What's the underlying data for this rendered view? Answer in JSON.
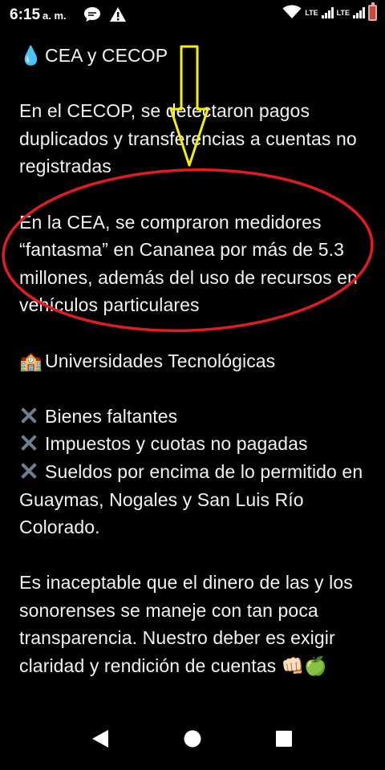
{
  "status_bar": {
    "time": "6:15",
    "ampm": "a. m.",
    "network_label_1": "LTE",
    "network_label_2": "LTE",
    "icons": [
      "chat-bubble-icon",
      "warning-icon",
      "wifi-icon",
      "signal-icon",
      "signal-icon",
      "battery-icon"
    ],
    "battery_color": "#c9473b"
  },
  "post": {
    "section1_emoji": "💧",
    "section1_title": "CEA y CECOP",
    "paragraph1": "En el CECOP, se detectaron pagos duplicados y transferencias a cuentas no registradas",
    "paragraph2": "En la CEA, se compraron medidores “fantasma” en Cananea por más de 5.3 millones, además del uso de recursos en vehículos particulares",
    "section2_emoji": "🏫",
    "section2_title": "Universidades Tecnológicas",
    "bullets": [
      "Bienes faltantes",
      "Impuestos y cuotas no pagadas",
      "Sueldos por encima de lo permitido en Guaymas, Nogales y San Luis Río Colorado."
    ],
    "closing": "Es inaceptable que el dinero de las y los sonorenses se maneje con tan poca transparencia. Nuestro deber es exigir claridad y rendición de cuentas",
    "closing_emojis": "👊🏻🍏"
  },
  "annotations": {
    "arrow_color": "#f5f000",
    "ellipse_color": "#e01b22"
  },
  "nav": {
    "icons": [
      "back-icon",
      "home-icon",
      "recents-icon"
    ]
  }
}
